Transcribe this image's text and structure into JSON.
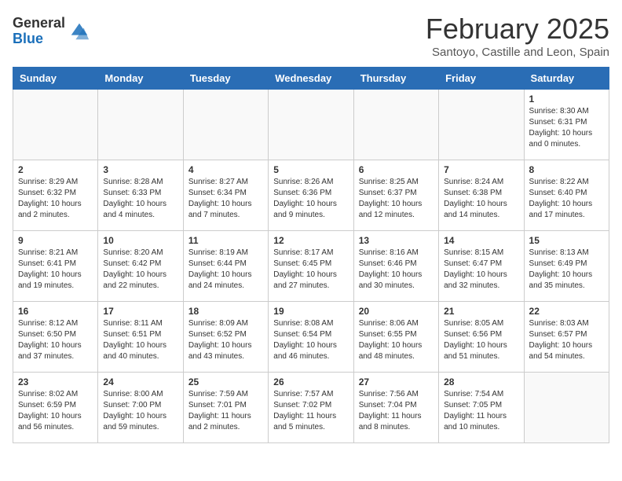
{
  "logo": {
    "general": "General",
    "blue": "Blue"
  },
  "title": "February 2025",
  "subtitle": "Santoyo, Castille and Leon, Spain",
  "days_of_week": [
    "Sunday",
    "Monday",
    "Tuesday",
    "Wednesday",
    "Thursday",
    "Friday",
    "Saturday"
  ],
  "weeks": [
    [
      {
        "day": "",
        "info": ""
      },
      {
        "day": "",
        "info": ""
      },
      {
        "day": "",
        "info": ""
      },
      {
        "day": "",
        "info": ""
      },
      {
        "day": "",
        "info": ""
      },
      {
        "day": "",
        "info": ""
      },
      {
        "day": "1",
        "info": "Sunrise: 8:30 AM\nSunset: 6:31 PM\nDaylight: 10 hours and 0 minutes."
      }
    ],
    [
      {
        "day": "2",
        "info": "Sunrise: 8:29 AM\nSunset: 6:32 PM\nDaylight: 10 hours and 2 minutes."
      },
      {
        "day": "3",
        "info": "Sunrise: 8:28 AM\nSunset: 6:33 PM\nDaylight: 10 hours and 4 minutes."
      },
      {
        "day": "4",
        "info": "Sunrise: 8:27 AM\nSunset: 6:34 PM\nDaylight: 10 hours and 7 minutes."
      },
      {
        "day": "5",
        "info": "Sunrise: 8:26 AM\nSunset: 6:36 PM\nDaylight: 10 hours and 9 minutes."
      },
      {
        "day": "6",
        "info": "Sunrise: 8:25 AM\nSunset: 6:37 PM\nDaylight: 10 hours and 12 minutes."
      },
      {
        "day": "7",
        "info": "Sunrise: 8:24 AM\nSunset: 6:38 PM\nDaylight: 10 hours and 14 minutes."
      },
      {
        "day": "8",
        "info": "Sunrise: 8:22 AM\nSunset: 6:40 PM\nDaylight: 10 hours and 17 minutes."
      }
    ],
    [
      {
        "day": "9",
        "info": "Sunrise: 8:21 AM\nSunset: 6:41 PM\nDaylight: 10 hours and 19 minutes."
      },
      {
        "day": "10",
        "info": "Sunrise: 8:20 AM\nSunset: 6:42 PM\nDaylight: 10 hours and 22 minutes."
      },
      {
        "day": "11",
        "info": "Sunrise: 8:19 AM\nSunset: 6:44 PM\nDaylight: 10 hours and 24 minutes."
      },
      {
        "day": "12",
        "info": "Sunrise: 8:17 AM\nSunset: 6:45 PM\nDaylight: 10 hours and 27 minutes."
      },
      {
        "day": "13",
        "info": "Sunrise: 8:16 AM\nSunset: 6:46 PM\nDaylight: 10 hours and 30 minutes."
      },
      {
        "day": "14",
        "info": "Sunrise: 8:15 AM\nSunset: 6:47 PM\nDaylight: 10 hours and 32 minutes."
      },
      {
        "day": "15",
        "info": "Sunrise: 8:13 AM\nSunset: 6:49 PM\nDaylight: 10 hours and 35 minutes."
      }
    ],
    [
      {
        "day": "16",
        "info": "Sunrise: 8:12 AM\nSunset: 6:50 PM\nDaylight: 10 hours and 37 minutes."
      },
      {
        "day": "17",
        "info": "Sunrise: 8:11 AM\nSunset: 6:51 PM\nDaylight: 10 hours and 40 minutes."
      },
      {
        "day": "18",
        "info": "Sunrise: 8:09 AM\nSunset: 6:52 PM\nDaylight: 10 hours and 43 minutes."
      },
      {
        "day": "19",
        "info": "Sunrise: 8:08 AM\nSunset: 6:54 PM\nDaylight: 10 hours and 46 minutes."
      },
      {
        "day": "20",
        "info": "Sunrise: 8:06 AM\nSunset: 6:55 PM\nDaylight: 10 hours and 48 minutes."
      },
      {
        "day": "21",
        "info": "Sunrise: 8:05 AM\nSunset: 6:56 PM\nDaylight: 10 hours and 51 minutes."
      },
      {
        "day": "22",
        "info": "Sunrise: 8:03 AM\nSunset: 6:57 PM\nDaylight: 10 hours and 54 minutes."
      }
    ],
    [
      {
        "day": "23",
        "info": "Sunrise: 8:02 AM\nSunset: 6:59 PM\nDaylight: 10 hours and 56 minutes."
      },
      {
        "day": "24",
        "info": "Sunrise: 8:00 AM\nSunset: 7:00 PM\nDaylight: 10 hours and 59 minutes."
      },
      {
        "day": "25",
        "info": "Sunrise: 7:59 AM\nSunset: 7:01 PM\nDaylight: 11 hours and 2 minutes."
      },
      {
        "day": "26",
        "info": "Sunrise: 7:57 AM\nSunset: 7:02 PM\nDaylight: 11 hours and 5 minutes."
      },
      {
        "day": "27",
        "info": "Sunrise: 7:56 AM\nSunset: 7:04 PM\nDaylight: 11 hours and 8 minutes."
      },
      {
        "day": "28",
        "info": "Sunrise: 7:54 AM\nSunset: 7:05 PM\nDaylight: 11 hours and 10 minutes."
      },
      {
        "day": "",
        "info": ""
      }
    ]
  ]
}
